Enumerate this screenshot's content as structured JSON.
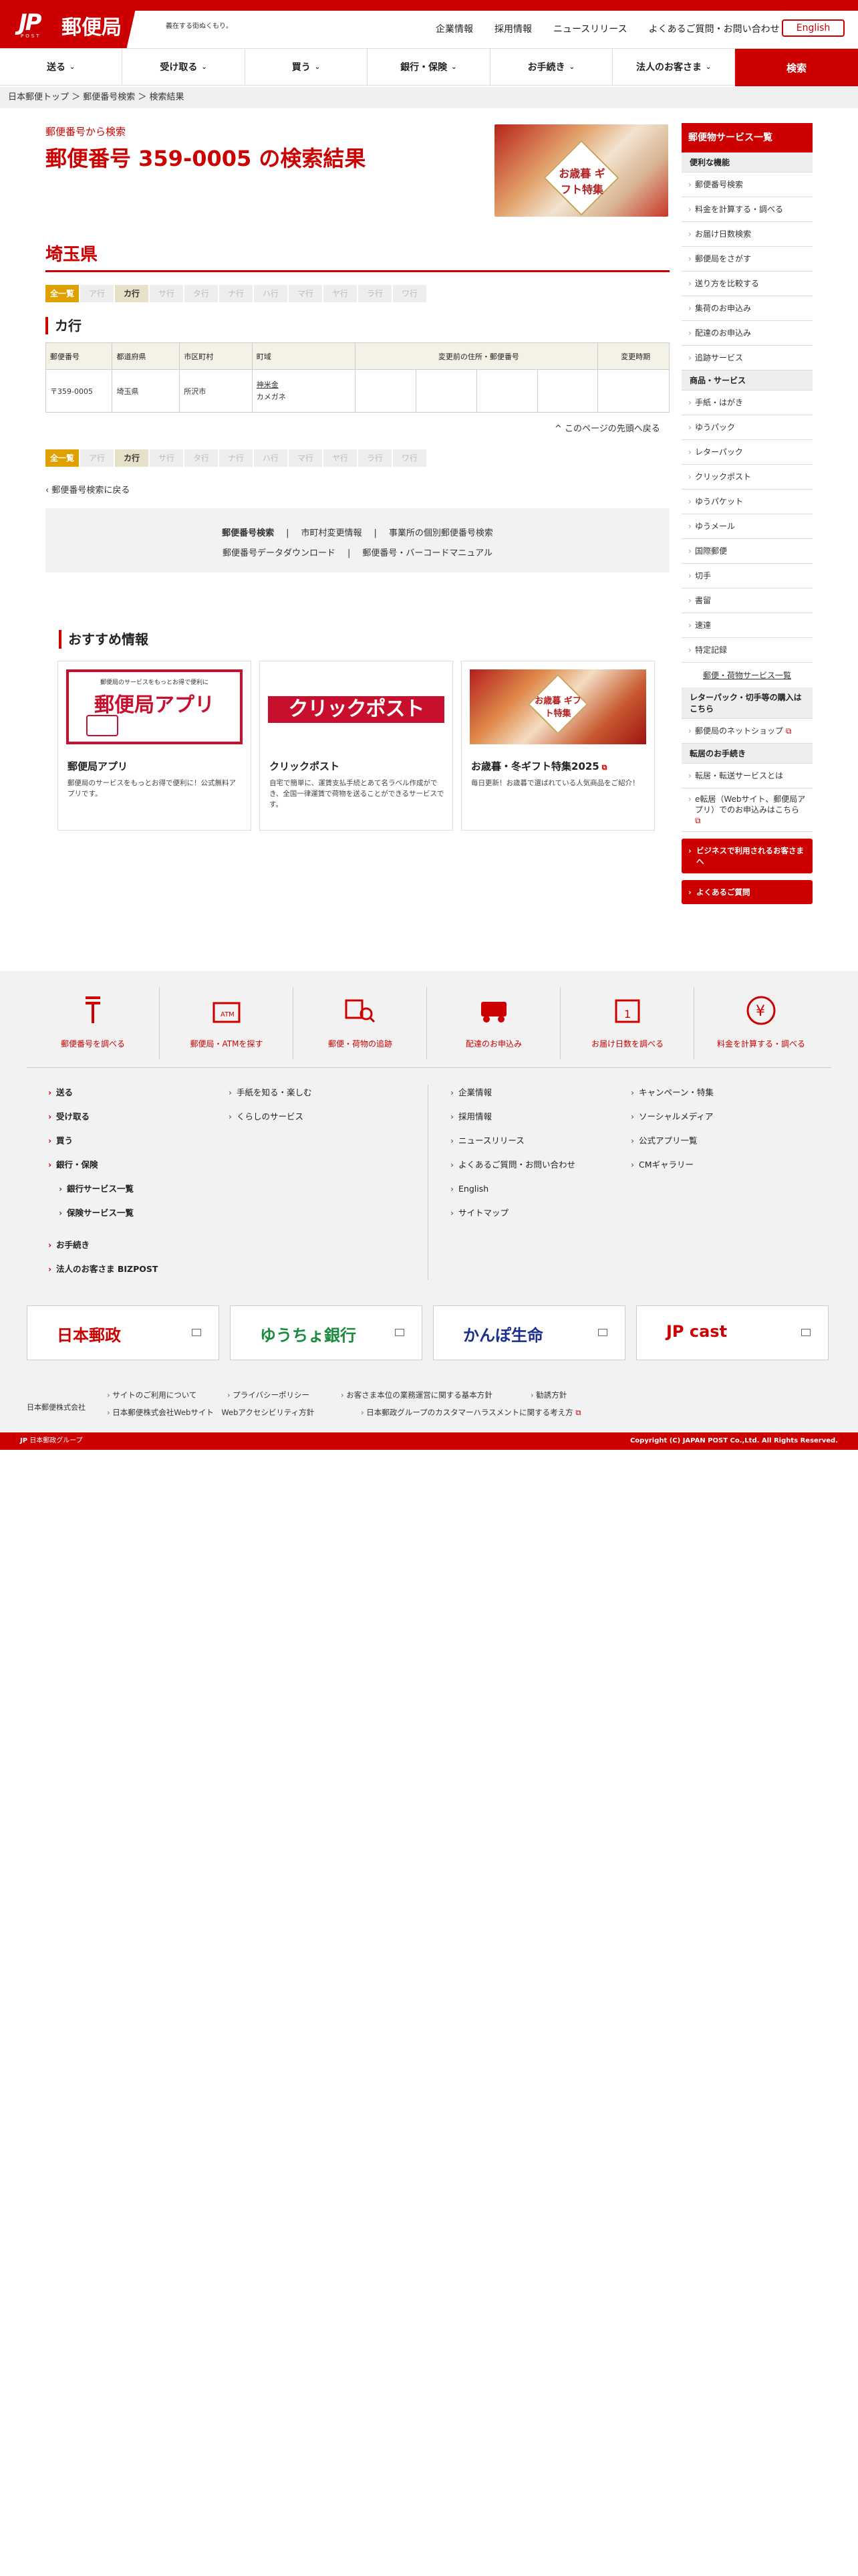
{
  "header": {
    "logo_text": "郵便局",
    "logo_post": "POST",
    "tagline": "義在する街ぬくもり。",
    "util_links": [
      "企業情報",
      "採用情報",
      "ニュースリリース",
      "よくあるご質問・お問い合わせ"
    ],
    "english": "English"
  },
  "nav": {
    "items": [
      "送る",
      "受け取る",
      "買う",
      "銀行・保険",
      "お手続き",
      "法人のお客さま"
    ],
    "search": "検索"
  },
  "breadcrumb": "日本郵便トップ ＞ 郵便番号検索 ＞ 検索結果",
  "main": {
    "subtitle": "郵便番号から検索",
    "title": "郵便番号 359-0005 の検索結果",
    "banner_text": "お歳暮 ギフト特集",
    "prefecture": "埼玉県",
    "kana_tabs": [
      "全一覧",
      "ア行",
      "カ行",
      "サ行",
      "タ行",
      "ナ行",
      "ハ行",
      "マ行",
      "ヤ行",
      "ラ行",
      "ワ行"
    ],
    "row_heading": "カ行",
    "table": {
      "headers": [
        "郵便番号",
        "都道府県",
        "市区町村",
        "町域",
        "変更前の住所・郵便番号",
        "変更時期"
      ],
      "row": {
        "zip": "〒359-0005",
        "pref": "埼玉県",
        "city": "所沢市",
        "town": "神米金",
        "town_kana": "カメガネ"
      }
    },
    "page_top": "このページの先頭へ戻る",
    "back": "郵便番号検索に戻る",
    "links_line1": [
      "郵便番号検索",
      "市町村変更情報",
      "事業所の個別郵便番号検索"
    ],
    "links_line2": [
      "郵便番号データダウンロード",
      "郵便番号・バーコードマニュアル"
    ]
  },
  "recommend": {
    "heading": "おすすめ情報",
    "cards": [
      {
        "title": "郵便局アプリ",
        "img_small": "郵便局のサービスをもっとお得で便利に",
        "img_big": "郵便局アプリ",
        "desc": "郵便局のサービスをもっとお得で便利に！公式無料アプリです。"
      },
      {
        "title": "クリックポスト",
        "img_big": "クリックポスト",
        "desc": "自宅で簡単に、運賃支払手続とあて名ラベル作成ができ、全国一律運賃で荷物を送ることができるサービスです。"
      },
      {
        "title": "お歳暮・冬ギフト特集2025",
        "img_big": "お歳暮 ギフト特集",
        "desc": "毎日更新！お歳暮で選ばれている人気商品をご紹介！"
      }
    ]
  },
  "sidebar": {
    "head": "郵便物サービス一覧",
    "cat1": "便利な機能",
    "items1": [
      "郵便番号検索",
      "料金を計算する・調べる",
      "お届け日数検索",
      "郵便局をさがす",
      "送り方を比較する",
      "集荷のお申込み",
      "配達のお申込み",
      "追跡サービス"
    ],
    "cat2": "商品・サービス",
    "items2": [
      "手紙・はがき",
      "ゆうパック",
      "レターパック",
      "クリックポスト",
      "ゆうパケット",
      "ゆうメール",
      "国際郵便",
      "切手",
      "書留",
      "速達",
      "特定記録"
    ],
    "all_link": "郵便・荷物サービス一覧",
    "cat3": "レターパック・切手等の購入はこちら",
    "items3": [
      "郵便局のネットショップ"
    ],
    "cat4": "転居のお手続き",
    "items4": [
      "転居・転送サービスとは",
      "e転居（Webサイト、郵便局アプリ）でのお申込みはこちら"
    ],
    "btn1": "ビジネスで利用されるお客さまへ",
    "btn2": "よくあるご質問"
  },
  "footer": {
    "quick": [
      "郵便番号を調べる",
      "郵便局・ATMを探す",
      "郵便・荷物の追跡",
      "配達のお申込み",
      "お届け日数を調べる",
      "料金を計算する・調べる"
    ],
    "col1": [
      "送る",
      "受け取る",
      "買う",
      "銀行・保険"
    ],
    "col1_sub": [
      "銀行サービス一覧",
      "保険サービス一覧"
    ],
    "col1_more": [
      "お手続き",
      "法人のお客さま BIZPOST"
    ],
    "col2": [
      "手紙を知る・楽しむ",
      "くらしのサービス"
    ],
    "col3": [
      "企業情報",
      "採用情報",
      "ニュースリリース",
      "よくあるご質問・お問い合わせ",
      "English",
      "サイトマップ"
    ],
    "col4": [
      "キャンペーン・特集",
      "ソーシャルメディア",
      "公式アプリ一覧",
      "CMギャラリー"
    ],
    "partners": [
      "日本郵政",
      "ゆうちょ銀行",
      "かんぽ生命",
      "JP cast"
    ],
    "corp": "日本郵便株式会社",
    "legal1": [
      "サイトのご利用について",
      "プライバシーポリシー",
      "お客さま本位の業務運営に関する基本方針",
      "勧誘方針"
    ],
    "legal2": [
      "日本郵便株式会社Webサイト　Webアクセシビリティ方針",
      "日本郵政グループのカスタマーハラスメントに関する考え方"
    ],
    "group": "日本郵政グループ",
    "copyright": "Copyright (C) JAPAN POST Co.,Ltd. All Rights Reserved."
  },
  "colors": {
    "brand_red": "#cc0000",
    "tab_all": "#e0a100"
  }
}
